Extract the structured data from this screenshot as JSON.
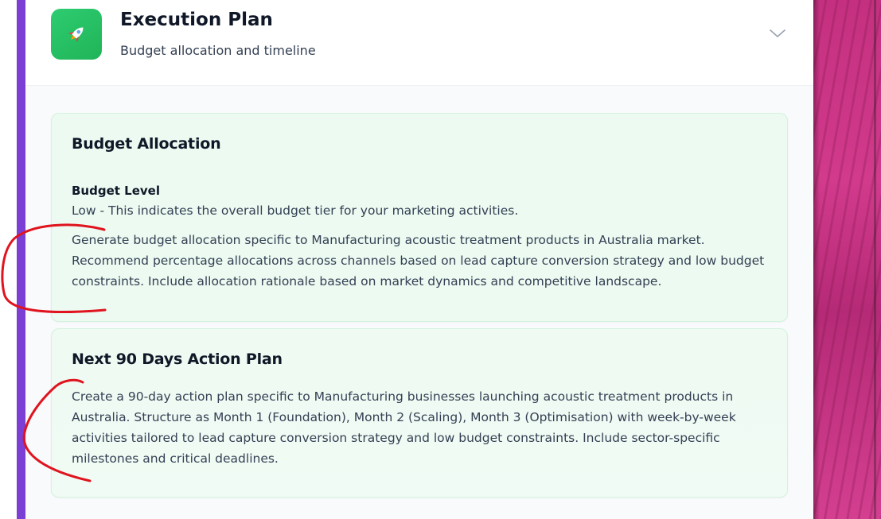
{
  "header": {
    "icon": "rocket-icon",
    "title": "Execution Plan",
    "subtitle": "Budget allocation and timeline",
    "toggle_icon": "chevron-down-icon"
  },
  "budget_allocation": {
    "heading": "Budget Allocation",
    "level_label": "Budget Level",
    "level_value": "Low - This indicates the overall budget tier for your marketing activities.",
    "description": "Generate budget allocation specific to Manufacturing acoustic treatment products in Australia market. Recommend percentage allocations across channels based on lead capture conversion strategy and low budget constraints. Include allocation rationale based on market dynamics and competitive landscape."
  },
  "action_plan": {
    "heading": "Next 90 Days Action Plan",
    "description": "Create a 90-day action plan specific to Manufacturing businesses launching acoustic treatment products in Australia. Structure as Month 1 (Foundation), Month 2 (Scaling), Month 3 (Optimisation) with week-by-week activities tailored to lead capture conversion strategy and low budget constraints. Include sector-specific milestones and critical deadlines."
  },
  "colors": {
    "accent_purple": "#7c3fd6",
    "icon_green": "#22c55e",
    "section_bg": "#ecfaf1",
    "annotation_red": "#e0141e",
    "backdrop_magenta": "#c4307f"
  }
}
